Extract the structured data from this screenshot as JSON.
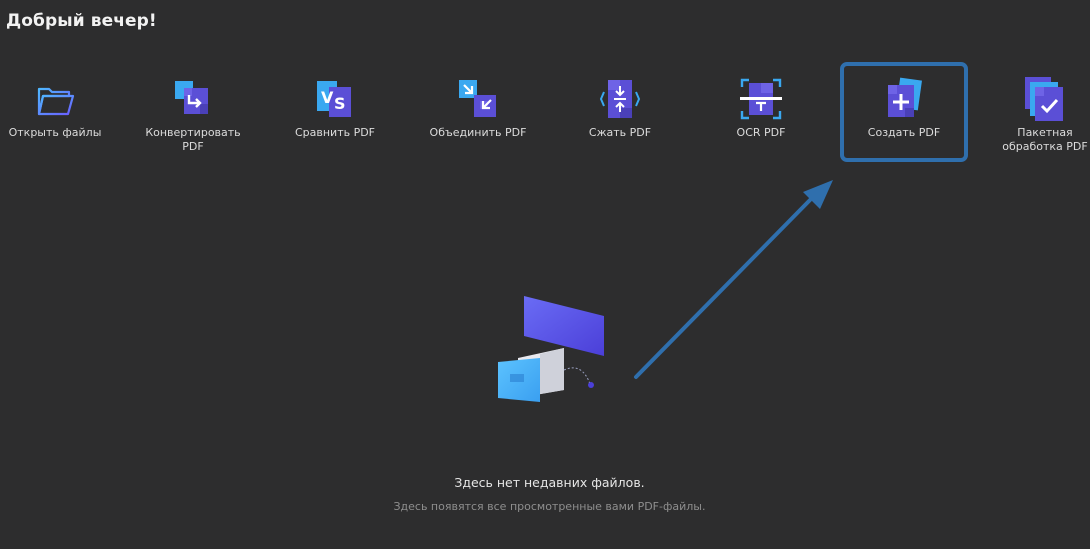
{
  "greeting": "Добрый вечер!",
  "tools": [
    {
      "id": "open",
      "icon": "folder-open-icon",
      "label": "Открыть файлы"
    },
    {
      "id": "convert",
      "icon": "convert-pdf-icon",
      "label": "Конвертировать PDF"
    },
    {
      "id": "compare",
      "icon": "compare-pdf-icon",
      "label": "Сравнить PDF"
    },
    {
      "id": "merge",
      "icon": "merge-pdf-icon",
      "label": "Объединить PDF"
    },
    {
      "id": "compress",
      "icon": "compress-pdf-icon",
      "label": "Сжать PDF"
    },
    {
      "id": "ocr",
      "icon": "ocr-pdf-icon",
      "label": "OCR PDF"
    },
    {
      "id": "create",
      "icon": "create-pdf-icon",
      "label": "Создать PDF"
    },
    {
      "id": "batch",
      "icon": "batch-process-icon",
      "label": "Пакетная обработка PDF"
    }
  ],
  "empty_state": {
    "title": "Здесь нет недавних файлов.",
    "subtitle": "Здесь появятся все просмотренные вами PDF-файлы."
  },
  "colors": {
    "background": "#2d2d2e",
    "highlight": "#2f6fad",
    "accent_purple": "#5b4fd6",
    "accent_blue": "#3aa8f0"
  }
}
